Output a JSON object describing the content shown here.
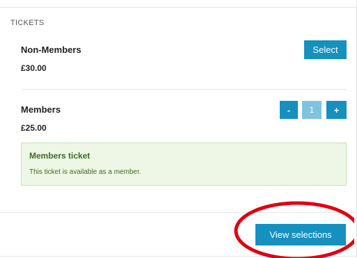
{
  "section": {
    "title": "TICKETS"
  },
  "tickets": [
    {
      "name": "Non-Members",
      "price": "£30.00",
      "action_label": "Select"
    },
    {
      "name": "Members",
      "price": "£25.00",
      "quantity": {
        "decrement_label": "-",
        "value": "1",
        "increment_label": "+"
      },
      "info": {
        "title": "Members ticket",
        "text": "This ticket is available as a member."
      }
    }
  ],
  "footer": {
    "view_selections_label": "View selections"
  },
  "colors": {
    "button": "#1590bf",
    "quantity_value_bg": "#7fc3de",
    "info_bg": "#eef7e6",
    "info_border": "#c9e2b4",
    "info_text": "#3d6a23",
    "annotation": "#e0000f"
  }
}
